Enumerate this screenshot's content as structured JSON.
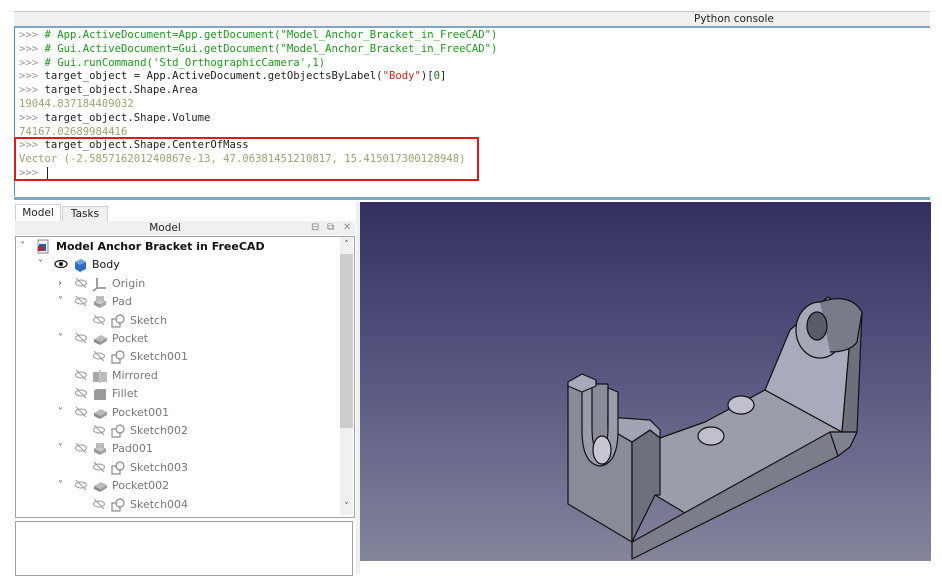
{
  "console": {
    "title": "Python console",
    "lines": [
      {
        "prompt": ">>> ",
        "comment": "# App.ActiveDocument=App.getDocument(\"Model_Anchor_Bracket_in_FreeCAD\")"
      },
      {
        "prompt": ">>> ",
        "comment": "# Gui.ActiveDocument=Gui.getDocument(\"Model_Anchor_Bracket_in_FreeCAD\")"
      },
      {
        "prompt": ">>> ",
        "comment": "# Gui.runCommand('Std_OrthographicCamera',1)"
      },
      {
        "prompt": ">>> ",
        "code_a": "target_object = App.ActiveDocument.getObjectsByLabel(",
        "str": "\"Body\"",
        "code_b": ")[",
        "num": "0",
        "code_c": "]"
      },
      {
        "prompt": ">>> ",
        "code": "target_object.Shape.Area"
      },
      {
        "output": "19044.837184409032"
      },
      {
        "prompt": ">>> ",
        "code": "target_object.Shape.Volume"
      },
      {
        "output": "74167.02689984416"
      },
      {
        "prompt": ">>> ",
        "code": "target_object.Shape.CenterOfMass"
      },
      {
        "output": "Vector (-2.585716201240867e-13, 47.06381451210817, 15.415017300128948)"
      },
      {
        "prompt": ">>> ",
        "code": ""
      }
    ],
    "highlight_color": "#e0191f"
  },
  "tabs": [
    {
      "label": "Model",
      "active": true
    },
    {
      "label": "Tasks",
      "active": false
    }
  ],
  "panel": {
    "title": "Model",
    "buttons": {
      "float": "⊟",
      "restore": "⧉",
      "close": "✕"
    }
  },
  "tree": [
    {
      "label": "Model Anchor Bracket in FreeCAD",
      "level": 0,
      "toggle": "expanded",
      "icon": "document-icon",
      "root": true
    },
    {
      "label": "Body",
      "level": 1,
      "toggle": "expanded",
      "icon": "body-icon",
      "visible": true
    },
    {
      "label": "Origin",
      "level": 2,
      "toggle": "collapsed",
      "icon": "origin-icon",
      "visible": false
    },
    {
      "label": "Pad",
      "level": 2,
      "toggle": "expanded",
      "icon": "pad-icon",
      "visible": false
    },
    {
      "label": "Sketch",
      "level": 3,
      "toggle": "none",
      "icon": "sketch-icon",
      "visible": false
    },
    {
      "label": "Pocket",
      "level": 2,
      "toggle": "expanded",
      "icon": "pocket-icon",
      "visible": false
    },
    {
      "label": "Sketch001",
      "level": 3,
      "toggle": "none",
      "icon": "sketch-icon",
      "visible": false
    },
    {
      "label": "Mirrored",
      "level": 2,
      "toggle": "none",
      "icon": "mirrored-icon",
      "visible": false
    },
    {
      "label": "Fillet",
      "level": 2,
      "toggle": "none",
      "icon": "fillet-icon",
      "visible": false
    },
    {
      "label": "Pocket001",
      "level": 2,
      "toggle": "expanded",
      "icon": "pocket-icon",
      "visible": false
    },
    {
      "label": "Sketch002",
      "level": 3,
      "toggle": "none",
      "icon": "sketch-icon",
      "visible": false
    },
    {
      "label": "Pad001",
      "level": 2,
      "toggle": "expanded",
      "icon": "pad-icon",
      "visible": false
    },
    {
      "label": "Sketch003",
      "level": 3,
      "toggle": "none",
      "icon": "sketch-icon",
      "visible": false
    },
    {
      "label": "Pocket002",
      "level": 2,
      "toggle": "expanded",
      "icon": "pocket-icon",
      "visible": false
    },
    {
      "label": "Sketch004",
      "level": 3,
      "toggle": "none",
      "icon": "sketch-icon",
      "visible": false
    }
  ],
  "scroll": {
    "up": "˄",
    "down": "˅"
  },
  "viewport": {
    "model_name": "anchor-bracket",
    "background_top": "#33305f",
    "background_bottom": "#85849c",
    "model_color": "#8e8f9c"
  }
}
